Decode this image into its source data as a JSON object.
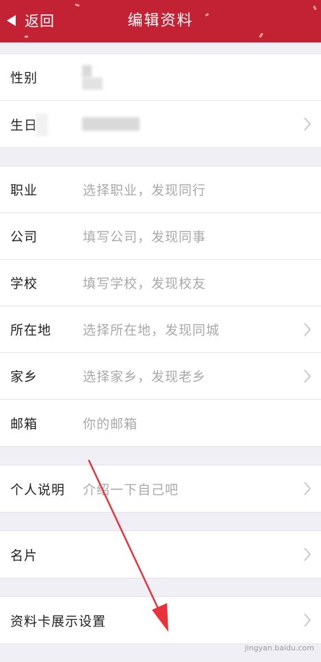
{
  "header": {
    "back_label": "返回",
    "title": "编辑资料",
    "background": "#c22233"
  },
  "groups": [
    [
      {
        "id": "gender",
        "label": "性别",
        "value": "",
        "chevron": false,
        "blurred": true
      },
      {
        "id": "birthday",
        "label": "生日",
        "value": "",
        "chevron": true,
        "blurred": true
      }
    ],
    [
      {
        "id": "job",
        "label": "职业",
        "value": "选择职业，发现同行",
        "chevron": false
      },
      {
        "id": "company",
        "label": "公司",
        "value": "填写公司，发现同事",
        "chevron": false
      },
      {
        "id": "school",
        "label": "学校",
        "value": "填写学校，发现校友",
        "chevron": false
      },
      {
        "id": "location",
        "label": "所在地",
        "value": "选择所在地，发现同城",
        "chevron": true
      },
      {
        "id": "hometown",
        "label": "家乡",
        "value": "选择家乡，发现老乡",
        "chevron": true
      },
      {
        "id": "email",
        "label": "邮箱",
        "value": "你的邮箱",
        "chevron": false
      }
    ],
    [
      {
        "id": "bio",
        "label": "个人说明",
        "value": "介绍一下自己吧",
        "chevron": true
      }
    ],
    [
      {
        "id": "card",
        "label": "名片",
        "value": "",
        "chevron": true
      }
    ],
    [
      {
        "id": "profile-card-settings",
        "label": "资料卡展示设置",
        "value": "",
        "chevron": true
      }
    ]
  ],
  "annotation_color": "#e8313a",
  "watermark": "jingyan.baidu.com"
}
